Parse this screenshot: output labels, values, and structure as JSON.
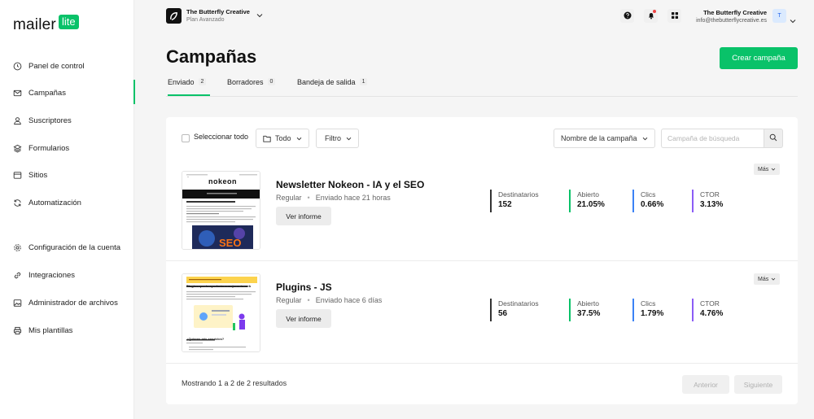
{
  "brand": {
    "logo_word": "mailer",
    "logo_badge": "lite"
  },
  "sidebar": {
    "items": [
      {
        "label": "Panel de control",
        "icon": "clock-icon"
      },
      {
        "label": "Campañas",
        "icon": "mail-icon"
      },
      {
        "label": "Suscriptores",
        "icon": "user-icon"
      },
      {
        "label": "Formularios",
        "icon": "layers-icon"
      },
      {
        "label": "Sitios",
        "icon": "browser-icon"
      },
      {
        "label": "Automatización",
        "icon": "refresh-icon"
      },
      {
        "label": "Configuración de la cuenta",
        "icon": "gear-icon"
      },
      {
        "label": "Integraciones",
        "icon": "link-icon"
      },
      {
        "label": "Administrador de archivos",
        "icon": "image-icon"
      },
      {
        "label": "Mis plantillas",
        "icon": "print-icon"
      }
    ]
  },
  "workspace": {
    "name": "The Butterfly Creative",
    "plan": "Plan Avanzado"
  },
  "user": {
    "name": "The Butterfly Creative",
    "email": "info@thebutterflycreative.es",
    "avatar": "T"
  },
  "page": {
    "title": "Campañas",
    "create_label": "Crear campaña"
  },
  "tabs": [
    {
      "label": "Enviado",
      "count": "2"
    },
    {
      "label": "Borradores",
      "count": "0"
    },
    {
      "label": "Bandeja de salida",
      "count": "1"
    }
  ],
  "filters": {
    "select_all": "Seleccionar todo",
    "folder": "Todo",
    "filter": "Filtro",
    "sort": "Nombre de la campaña",
    "search_placeholder": "Campaña de búsqueda"
  },
  "campaigns": [
    {
      "name": "Newsletter Nokeon - IA y el SEO",
      "type": "Regular",
      "sent": "Enviado hace 21 horas",
      "report_label": "Ver informe",
      "more_label": "Más",
      "stats": [
        {
          "label": "Destinatarios",
          "value": "152"
        },
        {
          "label": "Abierto",
          "value": "21.05%"
        },
        {
          "label": "Clics",
          "value": "0.66%"
        },
        {
          "label": "CTOR",
          "value": "3.13%"
        }
      ],
      "thumb": {
        "brand": "nokeon",
        "headline": "¿Quieres que te envíe una consultoría SEO?",
        "hero_text": "SEO"
      }
    },
    {
      "name": "Plugins - JS",
      "type": "Regular",
      "sent": "Enviado hace 6 días",
      "report_label": "Ver informe",
      "more_label": "Más",
      "stats": [
        {
          "label": "Destinatarios",
          "value": "56"
        },
        {
          "label": "Abierto",
          "value": "37.5%"
        },
        {
          "label": "Clics",
          "value": "1.79%"
        },
        {
          "label": "CTOR",
          "value": "4.76%"
        }
      ],
      "thumb": {
        "headline": "Plugins que te ayudarán a mejorar tu web",
        "subhead": "¿Quieres mis servicios?"
      }
    }
  ],
  "footer": {
    "results": "Mostrando 1 a 2 de 2 resultados",
    "prev": "Anterior",
    "next": "Siguiente"
  },
  "colors": {
    "accent": "#09c269",
    "recipients": "#333333",
    "opened": "#09c269",
    "clicks": "#3b82f6",
    "ctor": "#8b5cf6"
  }
}
